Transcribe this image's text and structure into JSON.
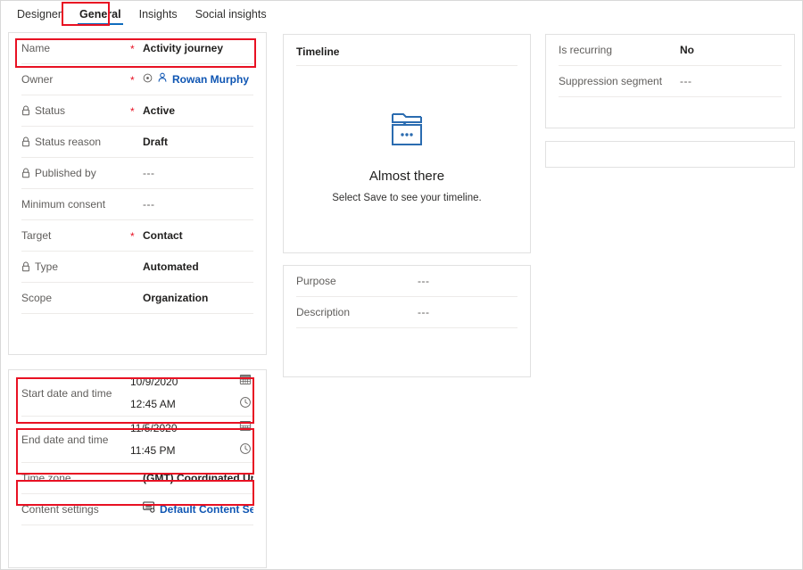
{
  "tabs": [
    {
      "label": "Designer",
      "selected": false
    },
    {
      "label": "General",
      "selected": true
    },
    {
      "label": "Insights",
      "selected": false
    },
    {
      "label": "Social insights",
      "selected": false
    }
  ],
  "colors": {
    "accent": "#0f6cbd",
    "link": "#0f56b3",
    "highlight": "#e81123",
    "required": "#e81123",
    "label": "#605e5c",
    "value": "#201f1e",
    "border": "#e1e1e1"
  },
  "main_card": {
    "fields": [
      {
        "label": "Name",
        "value": "Activity journey",
        "required": true,
        "locked": false,
        "style": "bold"
      },
      {
        "label": "Owner",
        "value": "Rowan Murphy",
        "required": true,
        "locked": false,
        "style": "link"
      },
      {
        "label": "Status",
        "value": "Active",
        "required": true,
        "locked": true,
        "style": "bold"
      },
      {
        "label": "Status reason",
        "value": "Draft",
        "required": false,
        "locked": true,
        "style": "bold"
      },
      {
        "label": "Published by",
        "value": "---",
        "required": false,
        "locked": true,
        "style": "dim"
      },
      {
        "label": "Minimum consent",
        "value": "---",
        "required": false,
        "locked": false,
        "style": "dim"
      },
      {
        "label": "Target",
        "value": "Contact",
        "required": true,
        "locked": false,
        "style": "bold"
      },
      {
        "label": "Type",
        "value": "Automated",
        "required": false,
        "locked": true,
        "style": "bold"
      },
      {
        "label": "Scope",
        "value": "Organization",
        "required": false,
        "locked": false,
        "style": "bold"
      }
    ]
  },
  "dates_card": {
    "start": {
      "label": "Start date and time",
      "date": "10/9/2020",
      "time": "12:45 AM"
    },
    "end": {
      "label": "End date and time",
      "date": "11/5/2020",
      "time": "11:45 PM"
    },
    "timezone": {
      "label": "Time zone",
      "value": "(GMT) Coordinated Universal Time"
    },
    "content_settings": {
      "label": "Content settings",
      "value": "Default Content Set..."
    }
  },
  "timeline_card": {
    "title": "Timeline",
    "empty_title": "Almost there",
    "empty_subtitle": "Select Save to see your timeline."
  },
  "purpose_card": {
    "fields": [
      {
        "label": "Purpose",
        "value": "---"
      },
      {
        "label": "Description",
        "value": "---"
      }
    ]
  },
  "right_card": {
    "fields": [
      {
        "label": "Is recurring",
        "value": "No",
        "style": "bold"
      },
      {
        "label": "Suppression segment",
        "value": "---",
        "style": "dim"
      }
    ]
  },
  "icons": {
    "lock": "lock-icon",
    "person": "person-icon",
    "lookup": "lookup-circle-icon",
    "calendar": "calendar-icon",
    "clock": "clock-icon",
    "content_settings": "content-settings-icon",
    "folder": "folder-stack-icon"
  }
}
